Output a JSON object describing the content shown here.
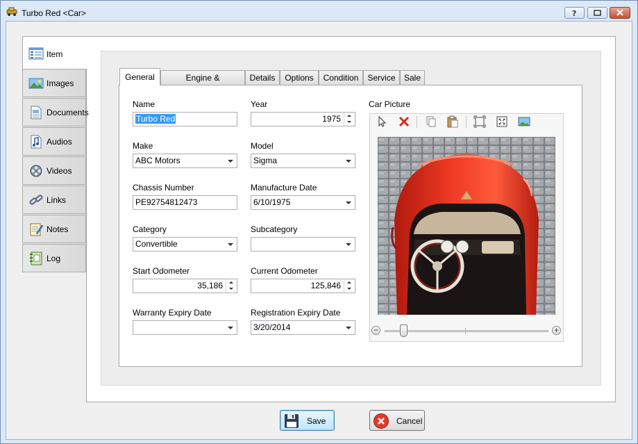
{
  "window": {
    "title": "Turbo Red <Car>"
  },
  "side_tabs": [
    {
      "label": "Item",
      "icon": "item-list-icon"
    },
    {
      "label": "Images",
      "icon": "image-icon"
    },
    {
      "label": "Documents",
      "icon": "document-icon"
    },
    {
      "label": "Audios",
      "icon": "music-note-icon"
    },
    {
      "label": "Videos",
      "icon": "film-reel-icon"
    },
    {
      "label": "Links",
      "icon": "chain-link-icon"
    },
    {
      "label": "Notes",
      "icon": "notepad-icon"
    },
    {
      "label": "Log",
      "icon": "log-book-icon"
    }
  ],
  "tabs": [
    "General",
    "Engine & Transmission",
    "Details",
    "Options",
    "Condition",
    "Service",
    "Sale"
  ],
  "form": {
    "name": {
      "label": "Name",
      "value": "Turbo Red"
    },
    "year": {
      "label": "Year",
      "value": "1975"
    },
    "make": {
      "label": "Make",
      "value": "ABC Motors"
    },
    "model": {
      "label": "Model",
      "value": "Sigma"
    },
    "chassis": {
      "label": "Chassis Number",
      "value": "PE92754812473"
    },
    "manufacture_date": {
      "label": "Manufacture Date",
      "value": "6/10/1975"
    },
    "category": {
      "label": "Category",
      "value": "Convertible"
    },
    "subcategory": {
      "label": "Subcategory",
      "value": ""
    },
    "start_odometer": {
      "label": "Start Odometer",
      "value": "35,186"
    },
    "current_odometer": {
      "label": "Current Odometer",
      "value": "125,846"
    },
    "warranty": {
      "label": "Warranty Expiry Date",
      "value": ""
    },
    "registration": {
      "label": "Registration Expiry Date",
      "value": "3/20/2014"
    }
  },
  "picture": {
    "label": "Car Picture",
    "zoom_level": 0.1
  },
  "buttons": {
    "save": "Save",
    "cancel": "Cancel"
  },
  "colors": {
    "accent": "#3399ff",
    "car_red": "#e02a17",
    "title_bar": "#dbe8f6"
  }
}
